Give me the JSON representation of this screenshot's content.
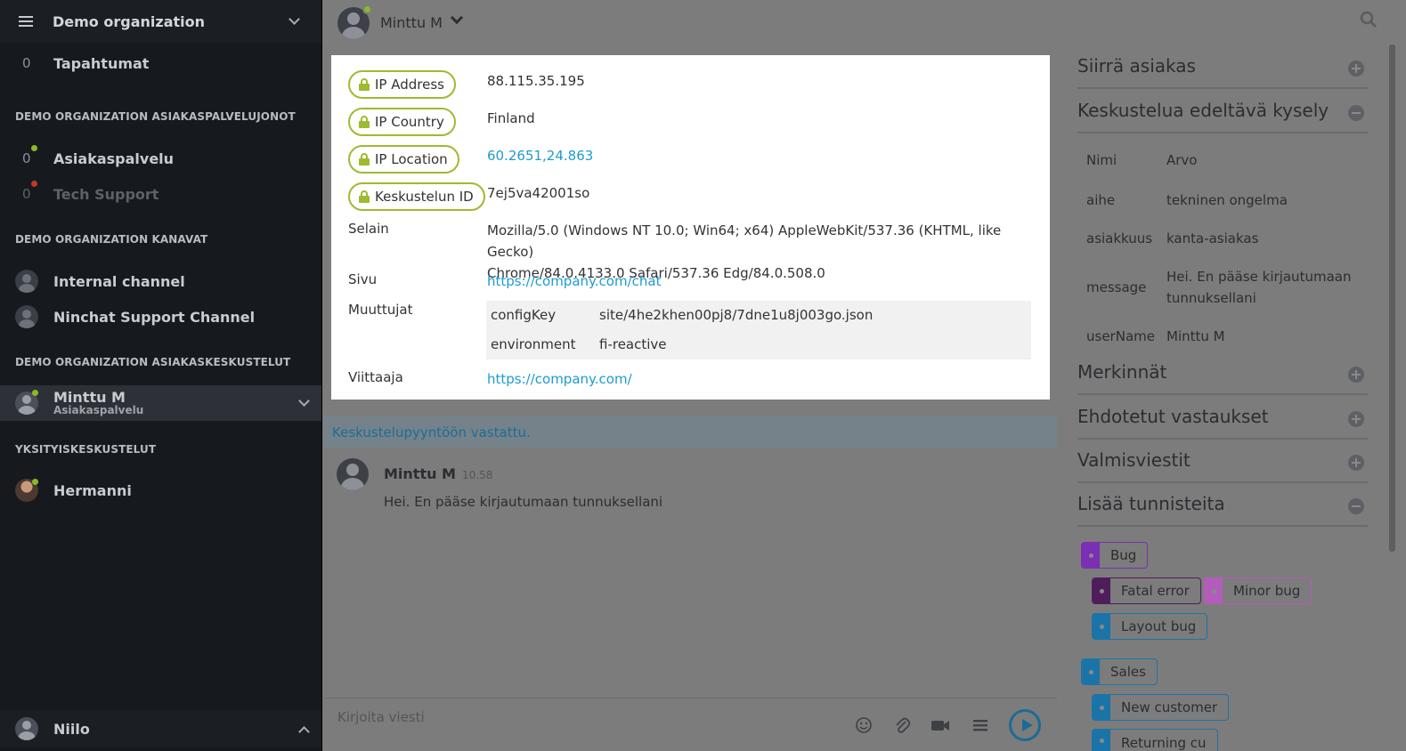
{
  "sidebar": {
    "org_name": "Demo organization",
    "events": {
      "count": "0",
      "label": "Tapahtumat"
    },
    "queues_header": "DEMO ORGANIZATION ASIAKASPALVELUJONOT",
    "queues": [
      {
        "count": "0",
        "label": "Asiakaspalvelu",
        "status_color": "#8ab924"
      },
      {
        "count": "0",
        "label": "Tech Support",
        "status_color": "#c0392b"
      }
    ],
    "channels_header": "DEMO ORGANIZATION KANAVAT",
    "channels": [
      {
        "label": "Internal channel"
      },
      {
        "label": "Ninchat Support Channel"
      }
    ],
    "conversations_header": "DEMO ORGANIZATION ASIAKASKESKUSTELUT",
    "active_conversation": {
      "name": "Minttu M",
      "queue": "Asiakaspalvelu"
    },
    "private_header": "YKSITYISKESKUSTELUT",
    "private": [
      {
        "label": "Hermanni"
      }
    ],
    "current_user": "Niilo"
  },
  "topbar": {
    "user_name": "Minttu M"
  },
  "info": {
    "ip_address_label": "IP Address",
    "ip_address": "88.115.35.195",
    "ip_country_label": "IP Country",
    "ip_country": "Finland",
    "ip_location_label": "IP Location",
    "ip_location": "60.2651,24.863",
    "chat_id_label": "Keskustelun ID",
    "chat_id": "7ej5va42001so",
    "browser_label": "Selain",
    "browser_line1": "Mozilla/5.0 (Windows NT 10.0; Win64; x64) AppleWebKit/537.36 (KHTML, like Gecko)",
    "browser_line2": "Chrome/84.0.4133.0 Safari/537.36 Edg/84.0.508.0",
    "page_label": "Sivu",
    "page": "https://company.com/chat",
    "vars_label": "Muuttujat",
    "vars": [
      {
        "key": "configKey",
        "value": "site/4he2khen00pj8/7dne1u8j003go.json"
      },
      {
        "key": "environment",
        "value": "fi-reactive"
      }
    ],
    "referrer_label": "Viittaaja",
    "referrer": "https://company.com/"
  },
  "chat": {
    "accepted": "Keskustelupyyntöön vastattu.",
    "message": {
      "sender": "Minttu M",
      "time": "10.58",
      "text": "Hei. En pääse kirjautumaan tunnuksellani"
    },
    "composer_placeholder": "Kirjoita viesti"
  },
  "right_panel": {
    "transfer": "Siirrä asiakas",
    "pre_survey": "Keskustelua edeltävä kysely",
    "survey": [
      {
        "key": "Nimi",
        "value": "Arvo"
      },
      {
        "key": "aihe",
        "value": "tekninen ongelma"
      },
      {
        "key": "asiakkuus",
        "value": "kanta-asiakas"
      },
      {
        "key": "message",
        "value_line1": "Hei. En pääse kirjautumaan",
        "value_line2": "tunnuksellani"
      },
      {
        "key": "userName",
        "value": "Minttu M"
      }
    ],
    "notes": "Merkinnät",
    "suggested": "Ehdotetut vastaukset",
    "ready_messages": "Valmisviestit",
    "add_tags": "Lisää tunnisteita",
    "tags": [
      {
        "label": "Bug",
        "color": "#7b2fb3"
      },
      {
        "label": "Fatal error",
        "color": "#4f1d5c"
      },
      {
        "label": "Minor bug",
        "color": "#b35dbb"
      },
      {
        "label": "Layout bug",
        "color": "#1b74a8"
      },
      {
        "label": "Sales",
        "color": "#1b74a8"
      },
      {
        "label": "New customer",
        "color": "#1b74a8"
      },
      {
        "label": "Returning cu",
        "color": "#1b74a8"
      }
    ]
  },
  "colors": {
    "accent_green": "#9dbb2f",
    "link_blue": "#1c9bd3",
    "sidebar_bg": "#16191e"
  }
}
